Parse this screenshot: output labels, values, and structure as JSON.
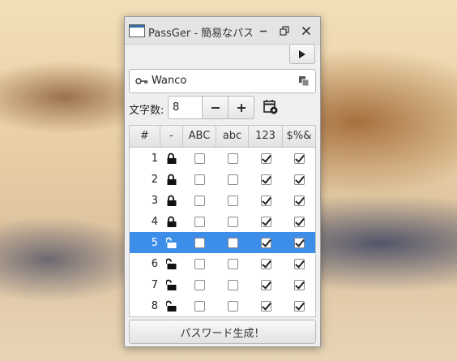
{
  "window": {
    "title": "PassGer - 簡易なパスワード生成"
  },
  "title_buttons": {
    "minimize": "minimize-icon",
    "restore": "restore-icon",
    "close": "close-icon"
  },
  "toolbar": {
    "run_icon": "play-icon"
  },
  "site": {
    "icon": "key-icon",
    "value": "Wanco",
    "copy_icon": "copy-icon"
  },
  "length": {
    "label": "文字数:",
    "value": "8",
    "minus": "−",
    "plus": "+"
  },
  "table": {
    "columns": [
      "#",
      "-",
      "ABC",
      "abc",
      "123",
      "$%&"
    ],
    "selected_row": 5,
    "rows": [
      {
        "num": "1",
        "locked": true,
        "upper": false,
        "lower": false,
        "digit": true,
        "symbol": true
      },
      {
        "num": "2",
        "locked": true,
        "upper": false,
        "lower": false,
        "digit": true,
        "symbol": true
      },
      {
        "num": "3",
        "locked": true,
        "upper": false,
        "lower": false,
        "digit": true,
        "symbol": true
      },
      {
        "num": "4",
        "locked": true,
        "upper": false,
        "lower": false,
        "digit": true,
        "symbol": true
      },
      {
        "num": "5",
        "locked": false,
        "upper": false,
        "lower": false,
        "digit": true,
        "symbol": true
      },
      {
        "num": "6",
        "locked": false,
        "upper": false,
        "lower": false,
        "digit": true,
        "symbol": true
      },
      {
        "num": "7",
        "locked": false,
        "upper": false,
        "lower": false,
        "digit": true,
        "symbol": true
      },
      {
        "num": "8",
        "locked": false,
        "upper": false,
        "lower": false,
        "digit": true,
        "symbol": true
      }
    ]
  },
  "actions": {
    "generate_label": "パスワード生成！"
  },
  "colors": {
    "selection": "#3d8ee9"
  }
}
